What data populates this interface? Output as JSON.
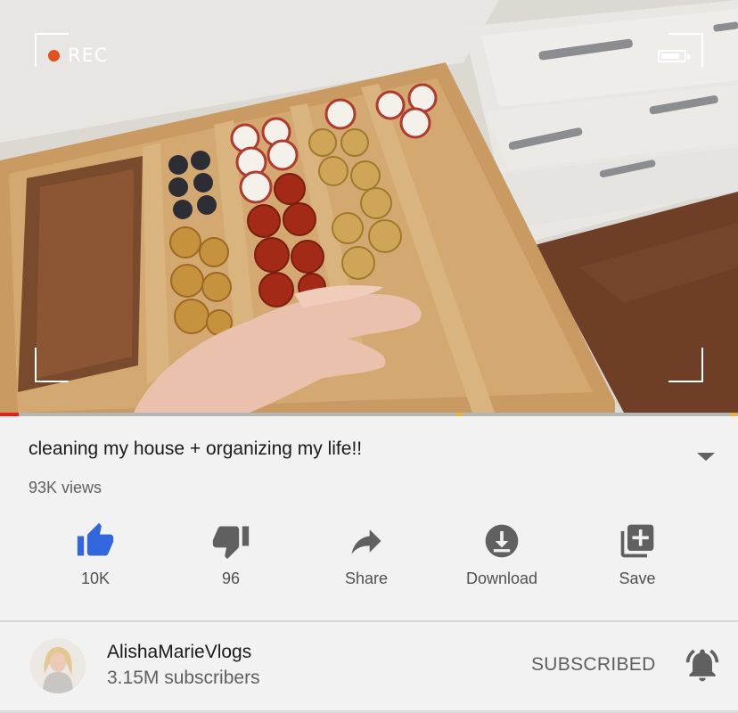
{
  "video": {
    "rec_label": "REC",
    "progress_fraction": 0.025,
    "colors": {
      "progress": "#e62117",
      "rec_dot": "#e2521f"
    }
  },
  "title": "cleaning my house + organizing my life!!",
  "views": "93K views",
  "actions": [
    {
      "icon": "thumb-up-icon",
      "label": "10K",
      "color": "#3166dd"
    },
    {
      "icon": "thumb-down-icon",
      "label": "96",
      "color": "#606060"
    },
    {
      "icon": "share-icon",
      "label": "Share",
      "color": "#606060"
    },
    {
      "icon": "download-icon",
      "label": "Download",
      "color": "#606060"
    },
    {
      "icon": "playlist-add-icon",
      "label": "Save",
      "color": "#606060"
    }
  ],
  "channel": {
    "name": "AlishaMarieVlogs",
    "subscribers": "3.15M subscribers",
    "subscribe_state": "SUBSCRIBED",
    "bell_icon": "notification-bell-icon"
  }
}
